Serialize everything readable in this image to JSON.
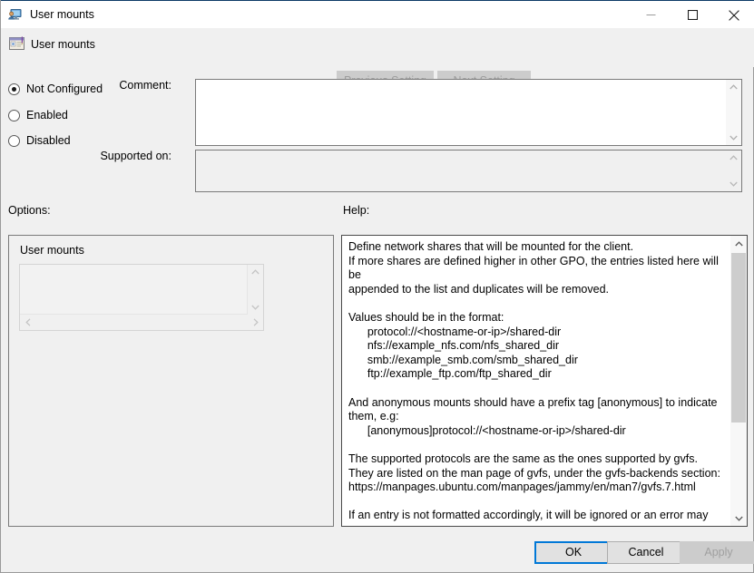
{
  "window": {
    "title": "User mounts",
    "icon": "user-monitor-icon",
    "minimize_label": "Minimize",
    "maximize_label": "Maximize",
    "close_label": "Close"
  },
  "header": {
    "title": "User mounts",
    "icon": "policy-setting-icon",
    "previous_setting_label": "Previous Setting",
    "next_setting_label": "Next Setting",
    "previous_enabled": false,
    "next_enabled": false
  },
  "state": {
    "options": [
      {
        "id": "not-configured",
        "label": "Not Configured",
        "selected": true
      },
      {
        "id": "enabled",
        "label": "Enabled",
        "selected": false
      },
      {
        "id": "disabled",
        "label": "Disabled",
        "selected": false
      }
    ]
  },
  "comment": {
    "label": "Comment:",
    "value": ""
  },
  "supported_on": {
    "label": "Supported on:",
    "value": ""
  },
  "sections": {
    "options_label": "Options:",
    "help_label": "Help:"
  },
  "options_panel": {
    "item_label": "User mounts",
    "list_values": [],
    "enabled": false
  },
  "help_panel": {
    "text": "Define network shares that will be mounted for the client.\nIf more shares are defined higher in other GPO, the entries listed here will be\nappended to the list and duplicates will be removed.\n\nValues should be in the format:\n      protocol://<hostname-or-ip>/shared-dir\n      nfs://example_nfs.com/nfs_shared_dir\n      smb://example_smb.com/smb_shared_dir\n      ftp://example_ftp.com/ftp_shared_dir\n\nAnd anonymous mounts should have a prefix tag [anonymous] to indicate\nthem, e.g:\n      [anonymous]protocol://<hostname-or-ip>/shared-dir\n\nThe supported protocols are the same as the ones supported by gvfs.\nThey are listed on the man page of gvfs, under the gvfs-backends section:\nhttps://manpages.ubuntu.com/manpages/jammy/en/man7/gvfs.7.html\n\nIf an entry is not formatted accordingly, it will be ignored or an error may occur."
  },
  "footer": {
    "ok_label": "OK",
    "cancel_label": "Cancel",
    "apply_label": "Apply",
    "apply_enabled": false
  },
  "colors": {
    "accent": "#0078d7",
    "dialog_bg": "#f0f0f0",
    "titlebar_bg": "#ffffff",
    "disabled_text": "#a0a0a0",
    "border": "#7a7a7a"
  }
}
